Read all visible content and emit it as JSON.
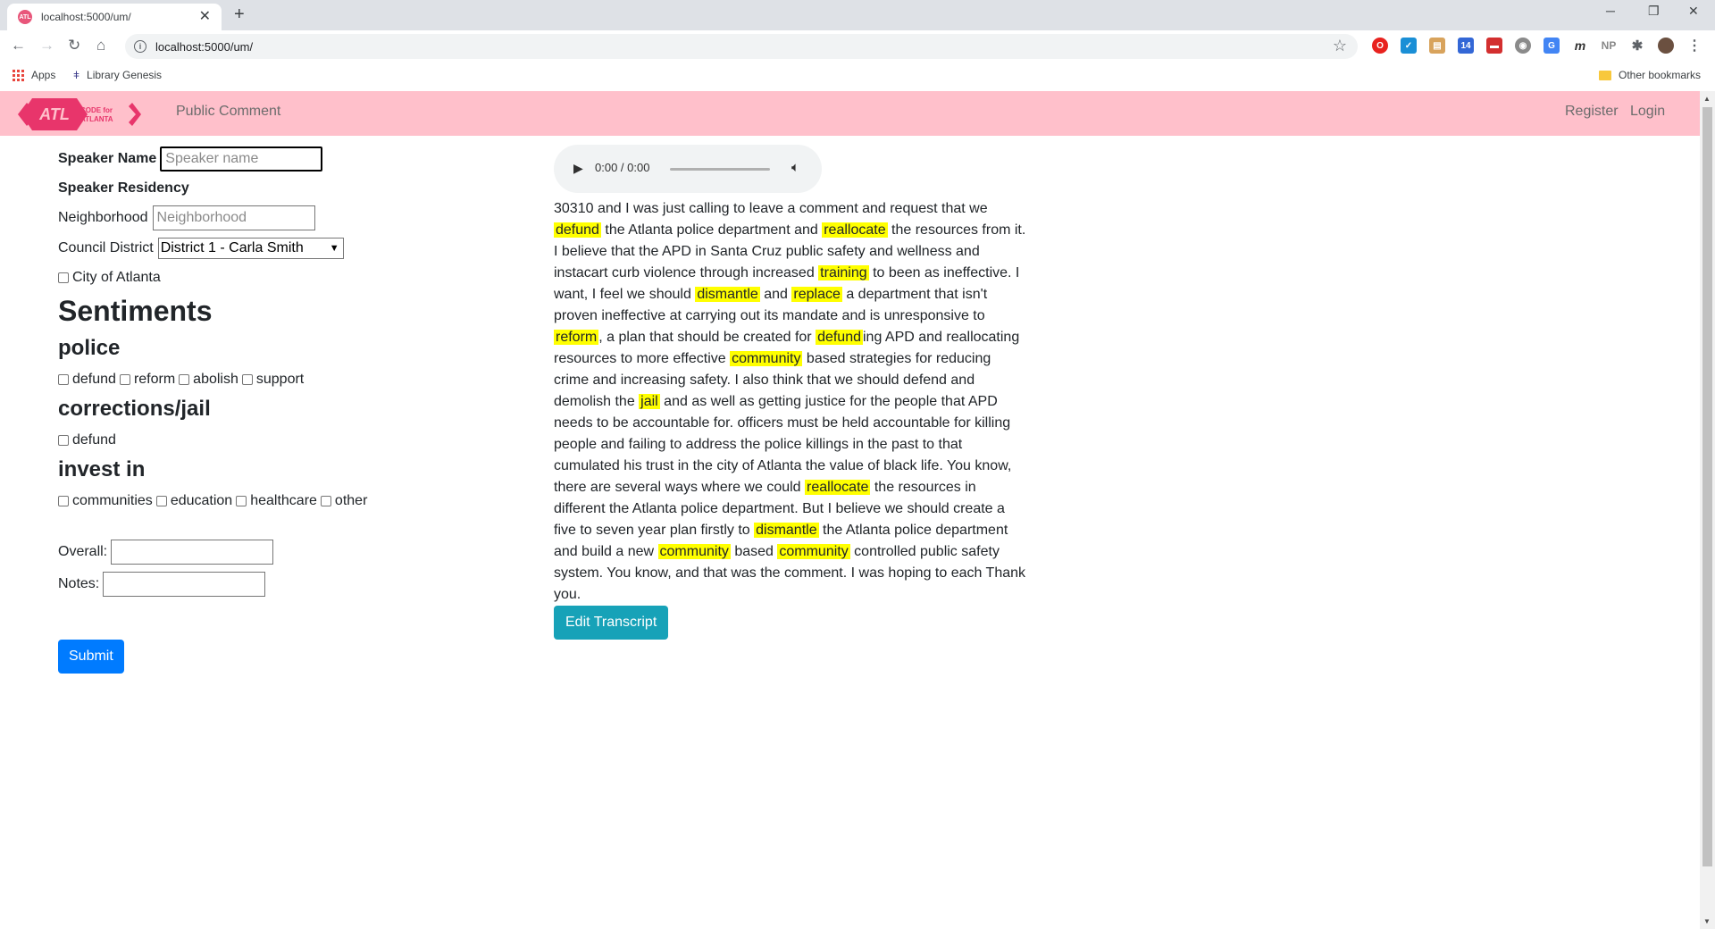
{
  "browser": {
    "tab_title": "localhost:5000/um/",
    "url": "localhost:5000/um/",
    "bookmarks": {
      "apps": "Apps",
      "libgen": "Library Genesis",
      "other": "Other bookmarks"
    }
  },
  "navbar": {
    "logo_text_top": "CODE for",
    "logo_text_bottom": "ATLANTA",
    "logo_mark": "ATL",
    "brand": "Public Comment",
    "register": "Register",
    "login": "Login",
    "bg_color": "#ffc0cb"
  },
  "form": {
    "speaker_name_label": "Speaker Name",
    "speaker_name_placeholder": "Speaker name",
    "residency_label": "Speaker Residency",
    "neighborhood_label": "Neighborhood",
    "neighborhood_placeholder": "Neighborhood",
    "council_label": "Council District",
    "council_selected": "District 1 - Carla Smith",
    "city_label": "City of Atlanta",
    "sentiments_heading": "Sentiments",
    "police": {
      "heading": "police",
      "options": [
        "defund",
        "reform",
        "abolish",
        "support"
      ]
    },
    "corrections": {
      "heading": "corrections/jail",
      "options": [
        "defund"
      ]
    },
    "invest": {
      "heading": "invest in",
      "options": [
        "communities",
        "education",
        "healthcare",
        "other"
      ]
    },
    "overall_label": "Overall:",
    "notes_label": "Notes:",
    "submit": "Submit"
  },
  "audio": {
    "time": "0:00 / 0:00"
  },
  "transcript": {
    "segments": [
      {
        "t": "30310 and I was just calling to leave a comment and request that we "
      },
      {
        "t": "defund",
        "hl": true
      },
      {
        "t": " the Atlanta police department and "
      },
      {
        "t": "reallocate",
        "hl": true
      },
      {
        "t": " the resources from it. I believe that the APD in Santa Cruz public safety and wellness and instacart curb violence through increased "
      },
      {
        "t": "training",
        "hl": true
      },
      {
        "t": " to been as ineffective. I want, I feel we should "
      },
      {
        "t": "dismantle",
        "hl": true
      },
      {
        "t": " and "
      },
      {
        "t": "replace",
        "hl": true
      },
      {
        "t": " a department that isn't proven ineffective at carrying out its mandate and is unresponsive to "
      },
      {
        "t": "reform",
        "hl": true
      },
      {
        "t": ", a plan that should be created for "
      },
      {
        "t": "defund",
        "hl": true
      },
      {
        "t": "ing APD and reallocating resources to more effective "
      },
      {
        "t": "community",
        "hl": true
      },
      {
        "t": " based strategies for reducing crime and increasing safety. I also think that we should defend and demolish the "
      },
      {
        "t": "jail",
        "hl": true
      },
      {
        "t": " and as well as getting justice for the people that APD needs to be accountable for. officers must be held accountable for killing people and failing to address the police killings in the past to that cumulated his trust in the city of Atlanta the value of black life. You know, there are several ways where we could "
      },
      {
        "t": "reallocate",
        "hl": true
      },
      {
        "t": " the resources in different the Atlanta police department. But I believe we should create a five to seven year plan firstly to "
      },
      {
        "t": "dismantle",
        "hl": true
      },
      {
        "t": " the Atlanta police department and build a new "
      },
      {
        "t": "community",
        "hl": true
      },
      {
        "t": " based "
      },
      {
        "t": "community",
        "hl": true
      },
      {
        "t": " controlled public safety system. You know, and that was the comment. I was hoping to each Thank you."
      }
    ],
    "highlight_color": "#ffff00"
  },
  "edit_button": "Edit Transcript"
}
